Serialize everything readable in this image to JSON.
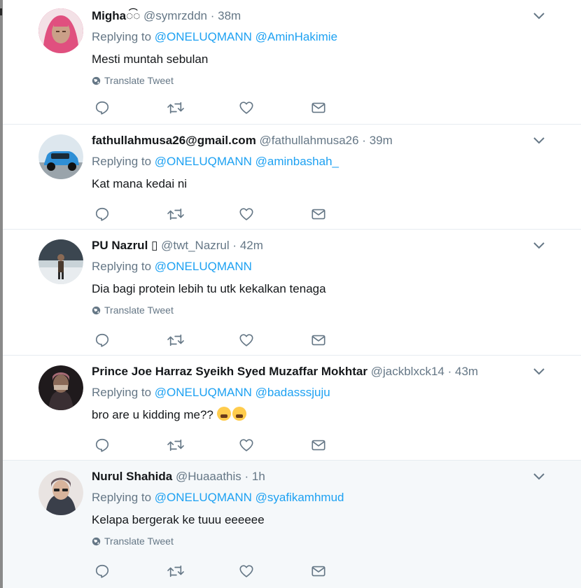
{
  "tweets": [
    {
      "name": "Migha◌͡◌",
      "handle": "@symrzddn",
      "time": "38m",
      "replying_label": "Replying to",
      "mentions": [
        "@ONELUQMANN",
        "@AminHakimie"
      ],
      "text": "Mesti muntah sebulan",
      "translate": "Translate Tweet"
    },
    {
      "name": "fathullahmusa26@gmail.com",
      "handle": "@fathullahmusa26",
      "time": "39m",
      "replying_label": "Replying to",
      "mentions": [
        "@ONELUQMANN",
        "@aminbashah_"
      ],
      "text": "Kat mana kedai ni"
    },
    {
      "name": "PU Nazrul ▯",
      "handle": "@twt_Nazrul",
      "time": "42m",
      "replying_label": "Replying to",
      "mentions": [
        "@ONELUQMANN"
      ],
      "text": "Dia bagi protein lebih tu utk kekalkan tenaga",
      "translate": "Translate Tweet"
    },
    {
      "name": "Prince Joe Harraz Syeikh Syed Muzaffar Mokhtar",
      "handle": "@jackblxck14",
      "time": "43m",
      "replying_label": "Replying to",
      "mentions": [
        "@ONELUQMANN",
        "@badasssjuju"
      ],
      "text": "bro are u kidding me??",
      "emoji": [
        "loudly-crying-face",
        "loudly-crying-face"
      ]
    },
    {
      "name": "Nurul Shahida",
      "handle": "@Huaaathis",
      "time": "1h",
      "replying_label": "Replying to",
      "mentions": [
        "@ONELUQMANN",
        "@syafikamhmud"
      ],
      "text": "Kelapa bergerak ke tuuu eeeeee",
      "translate": "Translate Tweet"
    }
  ],
  "dot": "·",
  "colors": {
    "link": "#1da1f2",
    "secondary_text": "#657786",
    "primary_text": "#14171a",
    "highlight_bg": "#f5f8fa",
    "divider": "#e6ecf0"
  },
  "icons": [
    "reply-icon",
    "retweet-icon",
    "like-icon",
    "direct-message-icon",
    "caret-down-icon",
    "globe-icon"
  ]
}
